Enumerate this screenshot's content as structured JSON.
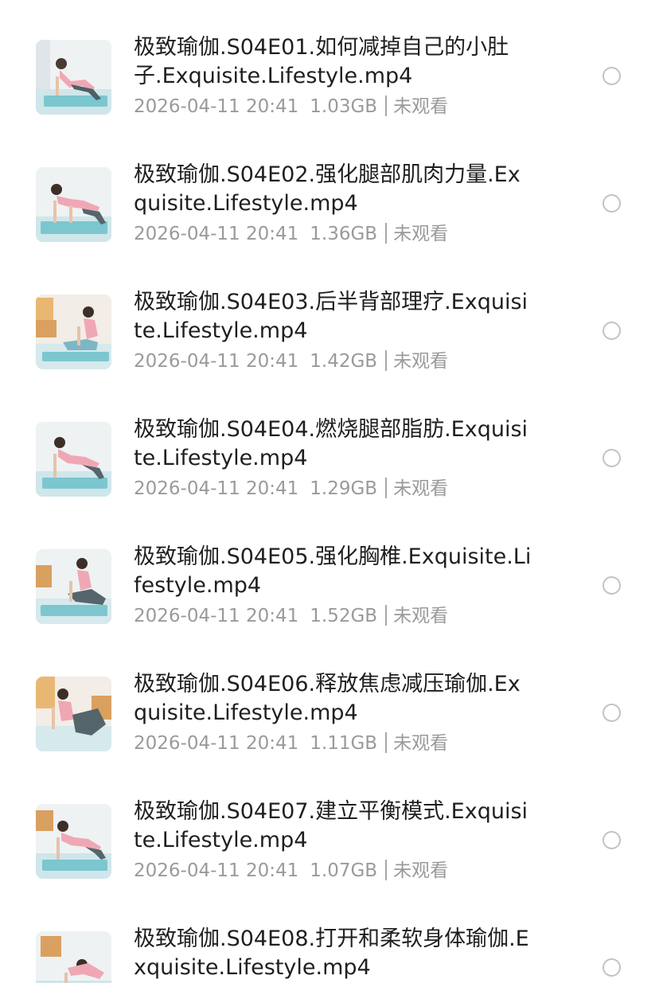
{
  "files": [
    {
      "title": "极致瑜伽.S04E01.如何减掉自己的小肚子.Exquisite.Lifestyle.mp4",
      "date": "2026-04-11 20:41",
      "size": "1.03GB",
      "status": "未观看"
    },
    {
      "title": "极致瑜伽.S04E02.强化腿部肌肉力量.Exquisite.Lifestyle.mp4",
      "date": "2026-04-11 20:41",
      "size": "1.36GB",
      "status": "未观看"
    },
    {
      "title": "极致瑜伽.S04E03.后半背部理疗.Exquisite.Lifestyle.mp4",
      "date": "2026-04-11 20:41",
      "size": "1.42GB",
      "status": "未观看"
    },
    {
      "title": "极致瑜伽.S04E04.燃烧腿部脂肪.Exquisite.Lifestyle.mp4",
      "date": "2026-04-11 20:41",
      "size": "1.29GB",
      "status": "未观看"
    },
    {
      "title": "极致瑜伽.S04E05.强化胸椎.Exquisite.Lifestyle.mp4",
      "date": "2026-04-11 20:41",
      "size": "1.52GB",
      "status": "未观看"
    },
    {
      "title": "极致瑜伽.S04E06.释放焦虑减压瑜伽.Exquisite.Lifestyle.mp4",
      "date": "2026-04-11 20:41",
      "size": "1.11GB",
      "status": "未观看"
    },
    {
      "title": "极致瑜伽.S04E07.建立平衡模式.Exquisite.Lifestyle.mp4",
      "date": "2026-04-11 20:41",
      "size": "1.07GB",
      "status": "未观看"
    },
    {
      "title": "极致瑜伽.S04E08.打开和柔软身体瑜伽.Exquisite.Lifestyle.mp4",
      "date": "",
      "size": "",
      "status": ""
    }
  ],
  "colors": {
    "title_text": "#1f1f1f",
    "meta_text": "#9a9a9a",
    "radio_border": "#c3c3c3",
    "mat": "#7cc6cf",
    "wall": "#eef2f3"
  },
  "icons": {
    "thumbnail": "video-thumbnail-icon",
    "select": "radio-unselected-icon"
  }
}
